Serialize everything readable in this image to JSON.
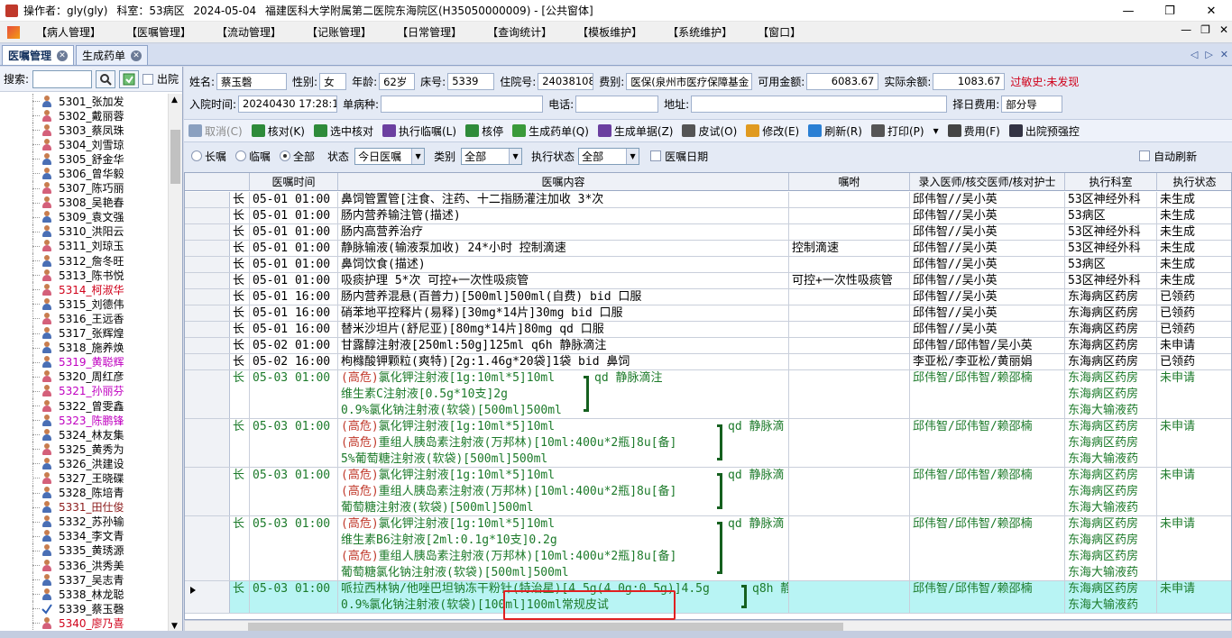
{
  "titlebar": {
    "operator": "操作者：gly(gly)",
    "dept": "科室：53病区",
    "date": "2024-05-04",
    "hospital": "福建医科大学附属第二医院东海院区(H35050000009) - [公共窗体]",
    "btn_min": "—",
    "btn_restore": "❐",
    "btn_close": "✕"
  },
  "menu": [
    "【病人管理】",
    "【医嘱管理】",
    "【流动管理】",
    "【记账管理】",
    "【日常管理】",
    "【查询统计】",
    "【模板维护】",
    "【系统维护】",
    "【窗口】"
  ],
  "mdi": {
    "min": "—",
    "restore": "❐",
    "close": "✕"
  },
  "tabs": [
    {
      "label": "医嘱管理"
    },
    {
      "label": "生成药单"
    }
  ],
  "tabnav": {
    "prev": "◁",
    "next": "▷",
    "close": "✕"
  },
  "left": {
    "search_label": "搜索:",
    "out_label": "出院",
    "search_value": ""
  },
  "patients": [
    {
      "name": "5301_张加发",
      "color": "#000",
      "sex": "m"
    },
    {
      "name": "5302_戴丽蓉",
      "color": "#000",
      "sex": "f"
    },
    {
      "name": "5303_蔡凤珠",
      "color": "#000",
      "sex": "f"
    },
    {
      "name": "5304_刘雪琼",
      "color": "#000",
      "sex": "f"
    },
    {
      "name": "5305_舒金华",
      "color": "#000",
      "sex": "m"
    },
    {
      "name": "5306_曾华毅",
      "color": "#000",
      "sex": "m"
    },
    {
      "name": "5307_陈巧丽",
      "color": "#000",
      "sex": "f"
    },
    {
      "name": "5308_吴艳春",
      "color": "#000",
      "sex": "f"
    },
    {
      "name": "5309_袁文强",
      "color": "#000",
      "sex": "m"
    },
    {
      "name": "5310_洪阳云",
      "color": "#000",
      "sex": "m"
    },
    {
      "name": "5311_刘琼玉",
      "color": "#000",
      "sex": "f"
    },
    {
      "name": "5312_詹冬旺",
      "color": "#000",
      "sex": "m"
    },
    {
      "name": "5313_陈书悦",
      "color": "#000",
      "sex": "f"
    },
    {
      "name": "5314_柯淑华",
      "color": "#d0021b",
      "sex": "f"
    },
    {
      "name": "5315_刘德伟",
      "color": "#000",
      "sex": "m"
    },
    {
      "name": "5316_王远香",
      "color": "#000",
      "sex": "f"
    },
    {
      "name": "5317_张辉煌",
      "color": "#000",
      "sex": "m"
    },
    {
      "name": "5318_施养焕",
      "color": "#000",
      "sex": "m"
    },
    {
      "name": "5319_黄聪辉",
      "color": "#c000c0",
      "sex": "m"
    },
    {
      "name": "5320_周红彦",
      "color": "#000",
      "sex": "f"
    },
    {
      "name": "5321_孙丽芬",
      "color": "#c000c0",
      "sex": "f"
    },
    {
      "name": "5322_曾雯鑫",
      "color": "#000",
      "sex": "f"
    },
    {
      "name": "5323_陈鹏锋",
      "color": "#c000c0",
      "sex": "m"
    },
    {
      "name": "5324_林友集",
      "color": "#000",
      "sex": "m"
    },
    {
      "name": "5325_黄秀为",
      "color": "#000",
      "sex": "f"
    },
    {
      "name": "5326_洪建设",
      "color": "#000",
      "sex": "m"
    },
    {
      "name": "5327_王晓碟",
      "color": "#000",
      "sex": "f"
    },
    {
      "name": "5328_陈培青",
      "color": "#000",
      "sex": "m"
    },
    {
      "name": "5331_田仕俊",
      "color": "#8b1a1a",
      "sex": "m"
    },
    {
      "name": "5332_苏孙输",
      "color": "#000",
      "sex": "m"
    },
    {
      "name": "5334_李文青",
      "color": "#000",
      "sex": "m"
    },
    {
      "name": "5335_黄琇源",
      "color": "#000",
      "sex": "m"
    },
    {
      "name": "5336_洪秀美",
      "color": "#000",
      "sex": "f"
    },
    {
      "name": "5337_吴志青",
      "color": "#000",
      "sex": "m"
    },
    {
      "name": "5338_林龙聪",
      "color": "#000",
      "sex": "m"
    },
    {
      "name": "5339_蔡玉磬",
      "color": "#000",
      "sex": "check"
    },
    {
      "name": "5340_廖乃喜",
      "color": "#d0021b",
      "sex": "f"
    }
  ],
  "patient_info": {
    "name_l": "姓名:",
    "name": "蔡玉磬",
    "sex_l": "性别:",
    "sex": "女",
    "age_l": "年龄:",
    "age": "62岁",
    "bed_l": "床号:",
    "bed": "5339",
    "admit_l": "住院号:",
    "admit": "24038108",
    "fee_l": "费别:",
    "fee": "医保(泉州市医疗保障基金",
    "avail_l": "可用金额:",
    "avail": "6083.67",
    "bal_l": "实际余额:",
    "bal": "1083.67",
    "allergy": "过敏史:未发现",
    "intime_l": "入院时间:",
    "intime": "20240430 17:28:15",
    "unit_l": "单病种:",
    "unit": "",
    "phone_l": "电话:",
    "phone": "",
    "addr_l": "地址:",
    "addr": "",
    "daily_l": "择日费用:",
    "daily": "部分导"
  },
  "toolbar": [
    {
      "label": "取消(C)",
      "color": "#8aa0c0",
      "disabled": true
    },
    {
      "label": "核对(K)",
      "color": "#2e8b3a"
    },
    {
      "label": "选中核对",
      "color": "#2e8b3a"
    },
    {
      "label": "执行临嘱(L)",
      "color": "#6b3fa0"
    },
    {
      "label": "核停",
      "color": "#2e8b3a"
    },
    {
      "label": "生成药单(Q)",
      "color": "#3a9a3a"
    },
    {
      "label": "生成单据(Z)",
      "color": "#6b3fa0"
    },
    {
      "label": "皮试(O)",
      "color": "#555"
    },
    {
      "label": "修改(E)",
      "color": "#e09a20"
    },
    {
      "label": "刷新(R)",
      "color": "#2a7fd4"
    },
    {
      "label": "打印(P)",
      "color": "#555"
    },
    {
      "label": "▾",
      "color": ""
    },
    {
      "label": "费用(F)",
      "color": "#444"
    },
    {
      "label": "出院预强控",
      "color": "#334"
    }
  ],
  "filters": {
    "long": "长嘱",
    "temp": "临嘱",
    "all": "全部",
    "status_l": "状态",
    "status": "今日医嘱",
    "cat_l": "类别",
    "cat": "全部",
    "exec_l": "执行状态",
    "exec": "全部",
    "date_l": "医嘱日期",
    "auto": "自动刷新"
  },
  "grid": {
    "headers": [
      "医嘱时间",
      "医嘱内容",
      "嘱咐",
      "录入医师/核交医师/核对护士",
      "执行科室",
      "执行状态"
    ],
    "rows": [
      {
        "type": "长",
        "time": "05-01 01:00",
        "lines": [
          "鼻饲管置管[注食、注药、十二指肠灌注加收  3*次"
        ],
        "note": "",
        "doctor": "邱伟智//吴小英",
        "depts": [
          "53区神经外科"
        ],
        "status": "未生成"
      },
      {
        "type": "长",
        "time": "05-01 01:00",
        "lines": [
          "肠内营养输注管(描述)"
        ],
        "note": "",
        "doctor": "邱伟智//吴小英",
        "depts": [
          "53病区"
        ],
        "status": "未生成"
      },
      {
        "type": "长",
        "time": "05-01 01:00",
        "lines": [
          "肠内高营养治疗"
        ],
        "note": "",
        "doctor": "邱伟智//吴小英",
        "depts": [
          "53区神经外科"
        ],
        "status": "未生成"
      },
      {
        "type": "长",
        "time": "05-01 01:00",
        "lines": [
          "静脉输液(输液泵加收)  24*小时 控制滴速"
        ],
        "note": "控制滴速",
        "doctor": "邱伟智//吴小英",
        "depts": [
          "53区神经外科"
        ],
        "status": "未生成"
      },
      {
        "type": "长",
        "time": "05-01 01:00",
        "lines": [
          "鼻饲饮食(描述)"
        ],
        "note": "",
        "doctor": "邱伟智//吴小英",
        "depts": [
          "53病区"
        ],
        "status": "未生成"
      },
      {
        "type": "长",
        "time": "05-01 01:00",
        "lines": [
          "吸痰护理  5*次 可控+一次性吸痰管"
        ],
        "note": "可控+一次性吸痰管",
        "doctor": "邱伟智//吴小英",
        "depts": [
          "53区神经外科"
        ],
        "status": "未生成"
      },
      {
        "type": "长",
        "time": "05-01 16:00",
        "lines": [
          "肠内营养混悬(百普力)[500ml]500ml(自费)  bid 口服"
        ],
        "note": "",
        "doctor": "邱伟智//吴小英",
        "depts": [
          "东海病区药房"
        ],
        "status": "已领药"
      },
      {
        "type": "长",
        "time": "05-01 16:00",
        "lines": [
          "硝苯地平控释片(易释)[30mg*14片]30mg  bid 口服"
        ],
        "note": "",
        "doctor": "邱伟智//吴小英",
        "depts": [
          "东海病区药房"
        ],
        "status": "已领药"
      },
      {
        "type": "长",
        "time": "05-01 16:00",
        "lines": [
          "替米沙坦片(舒尼亚)[80mg*14片]80mg  qd 口服"
        ],
        "note": "",
        "doctor": "邱伟智//吴小英",
        "depts": [
          "东海病区药房"
        ],
        "status": "已领药"
      },
      {
        "type": "长",
        "time": "05-02 01:00",
        "lines": [
          "甘露醇注射液[250ml:50g]125ml  q6h 静脉滴注"
        ],
        "note": "",
        "doctor": "邱伟智/邱伟智/吴小英",
        "depts": [
          "东海病区药房"
        ],
        "status": "未申请"
      },
      {
        "type": "长",
        "time": "05-02 16:00",
        "lines": [
          "枸橼酸钾颗粒(爽特)[2g:1.46g*20袋]1袋  bid 鼻饲"
        ],
        "note": "",
        "doctor": "李亚松/李亚松/黄丽娟",
        "depts": [
          "东海病区药房"
        ],
        "status": "已领药"
      }
    ],
    "groups": [
      {
        "type": "长",
        "time": "05-03 01:00",
        "lines": [
          [
            "(高危)",
            "氯化钾注射液[1g:10ml*5]10ml"
          ],
          [
            "",
            "维生素C注射液[0.5g*10支]2g"
          ],
          [
            "",
            "0.9%氯化钠注射液(软袋)[500ml]500ml"
          ]
        ],
        "usage": "qd 静脉滴注",
        "doctor": "邱伟智/邱伟智/赖邵楠",
        "depts": [
          "东海病区药房",
          "东海病区药房",
          "东海大输液药"
        ],
        "status": "未申请"
      },
      {
        "type": "长",
        "time": "05-03 01:00",
        "lines": [
          [
            "(高危)",
            "氯化钾注射液[1g:10ml*5]10ml"
          ],
          [
            "(高危)",
            "重组人胰岛素注射液(万邦林)[10ml:400u*2瓶]8u[备]"
          ],
          [
            "",
            "5%葡萄糖注射液(软袋)[500ml]500ml"
          ]
        ],
        "usage": "qd 静脉滴",
        "doctor": "邱伟智/邱伟智/赖邵楠",
        "depts": [
          "东海病区药房",
          "东海病区药房",
          "东海大输液药"
        ],
        "status": "未申请"
      },
      {
        "type": "长",
        "time": "05-03 01:00",
        "lines": [
          [
            "(高危)",
            "氯化钾注射液[1g:10ml*5]10ml"
          ],
          [
            "(高危)",
            "重组人胰岛素注射液(万邦林)[10ml:400u*2瓶]8u[备]"
          ],
          [
            "",
            "葡萄糖注射液(软袋)[500ml]500ml"
          ]
        ],
        "usage": "qd 静脉滴",
        "doctor": "邱伟智/邱伟智/赖邵楠",
        "depts": [
          "东海病区药房",
          "东海病区药房",
          "东海大输液药"
        ],
        "status": "未申请"
      },
      {
        "type": "长",
        "time": "05-03 01:00",
        "lines": [
          [
            "(高危)",
            "氯化钾注射液[1g:10ml*5]10ml"
          ],
          [
            "",
            "维生素B6注射液[2ml:0.1g*10支]0.2g"
          ],
          [
            "(高危)",
            "重组人胰岛素注射液(万邦林)[10ml:400u*2瓶]8u[备]"
          ],
          [
            "",
            "葡萄糖氯化钠注射液(软袋)[500ml]500ml"
          ]
        ],
        "usage": "qd 静脉滴",
        "doctor": "邱伟智/邱伟智/赖邵楠",
        "depts": [
          "东海病区药房",
          "东海病区药房",
          "东海病区药房",
          "东海大输液药"
        ],
        "status": "未申请"
      },
      {
        "type": "长",
        "time": "05-03 01:00",
        "lines": [
          [
            "",
            "哌拉西林钠/他唑巴坦钠冻干粉针(特治星)[4.5g(4.0g:0.5g)]4.5g"
          ],
          [
            "",
            "0.9%氯化钠注射液(软袋)[100ml]100ml常规皮试"
          ]
        ],
        "usage": "q8h 静",
        "doctor": "邱伟智/邱伟智/赖邵楠",
        "depts": [
          "东海病区药房",
          "东海大输液药"
        ],
        "status": "未申请",
        "current": true
      }
    ]
  }
}
